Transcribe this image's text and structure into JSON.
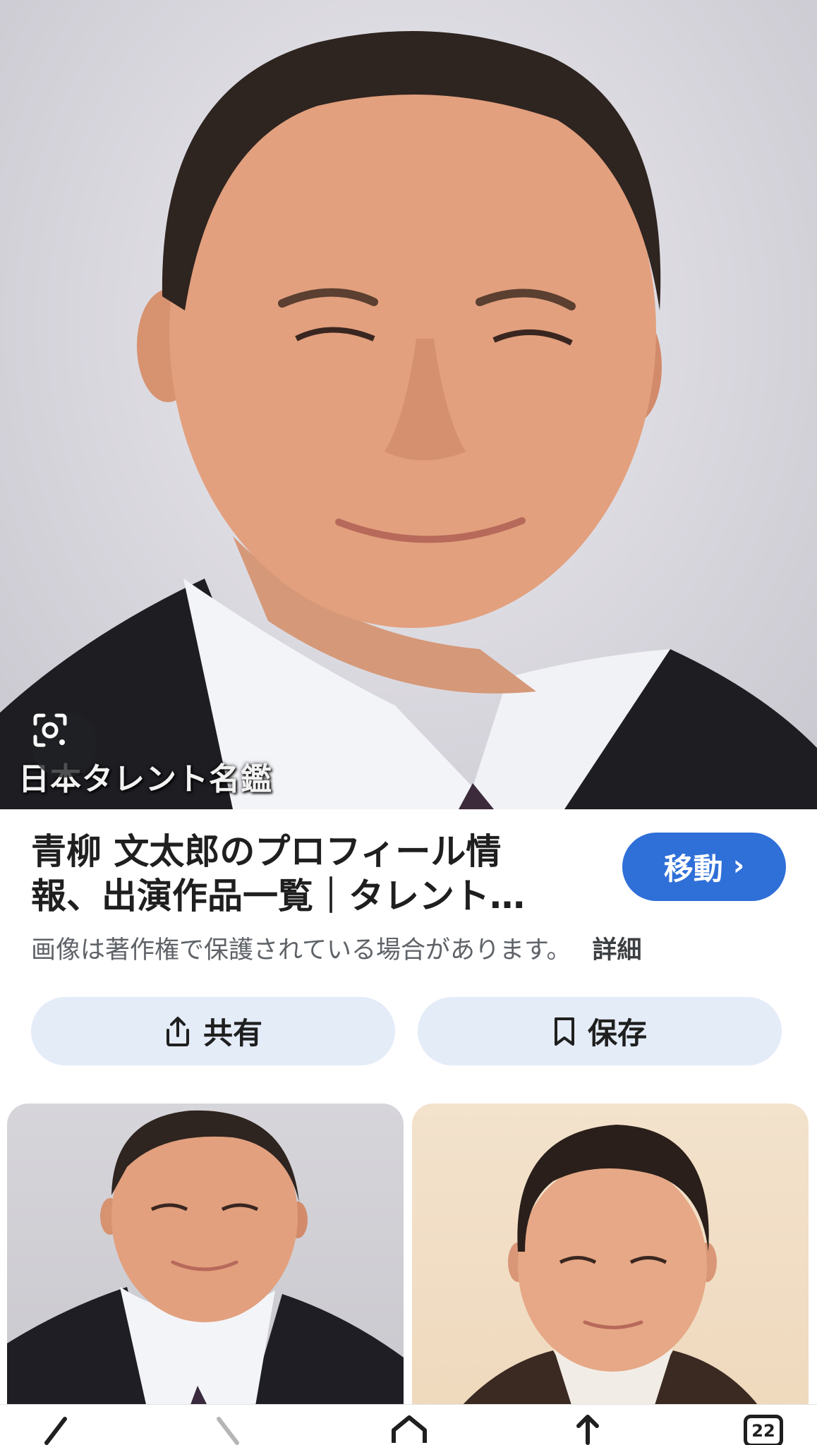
{
  "hero": {
    "watermark": "日本タレント名鑑",
    "lens_icon": "google-lens-icon"
  },
  "result": {
    "title_line1": "青柳 文太郎のプロフィール情",
    "title_line2": "報、出演作品一覧｜タレント…",
    "visit_label": "移動",
    "visit_icon": "chevron-right-icon",
    "copyright_notice": "画像は著作権で保護されている場合があります。",
    "details_link": "詳細"
  },
  "actions": {
    "share_label": "共有",
    "share_icon": "share-icon",
    "save_label": "保存",
    "save_icon": "bookmark-icon"
  },
  "related": [
    {
      "icon": "thumbnail-image"
    },
    {
      "icon": "thumbnail-image"
    }
  ],
  "bottom_nav": {
    "items": [
      "back-icon",
      "forward-icon",
      "home-icon",
      "share-icon",
      "tabs-icon"
    ],
    "tabs_count": "22"
  },
  "colors": {
    "accent": "#2f6fd8",
    "chip_bg": "#e4ecf8",
    "muted_text": "#5f6368"
  }
}
